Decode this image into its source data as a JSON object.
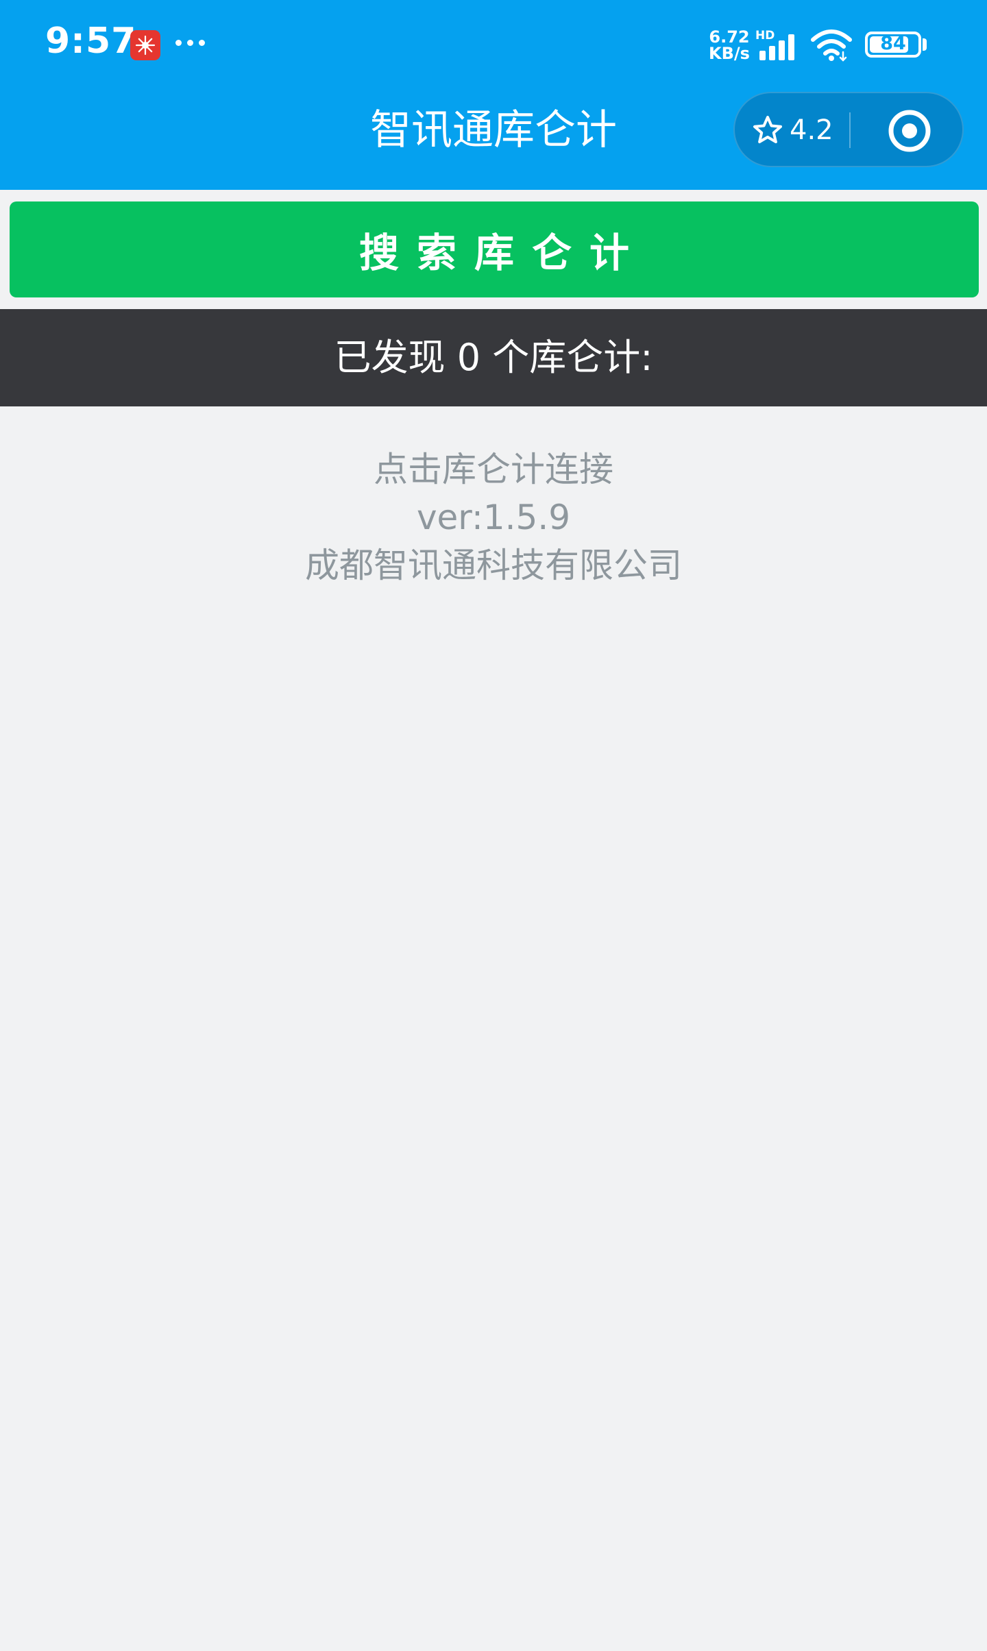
{
  "status_bar": {
    "time": "9:57",
    "net_speed_value": "6.72",
    "net_speed_unit": "KB/s",
    "network_type": "HD",
    "battery_level": "84"
  },
  "header": {
    "title": "智讯通库仑计",
    "rating": "4.2"
  },
  "search_button": {
    "label": "搜索库仑计"
  },
  "found_bar": {
    "text": "已发现 0 个库仑计:"
  },
  "info": {
    "hint": "点击库仑计连接",
    "version": "ver:1.5.9",
    "company": "成都智讯通科技有限公司"
  },
  "colors": {
    "header_bg": "#05a1ef",
    "button_green": "#07c160",
    "found_bar_bg": "#37383c",
    "page_bg": "#f1f2f3",
    "info_text": "#8e979d"
  },
  "icons": {
    "notification": "app-notification-icon",
    "more": "more-dots-icon",
    "signal": "signal-icon",
    "wifi": "wifi-icon",
    "battery": "battery-icon",
    "rating": "star-icon",
    "target": "target-icon"
  }
}
